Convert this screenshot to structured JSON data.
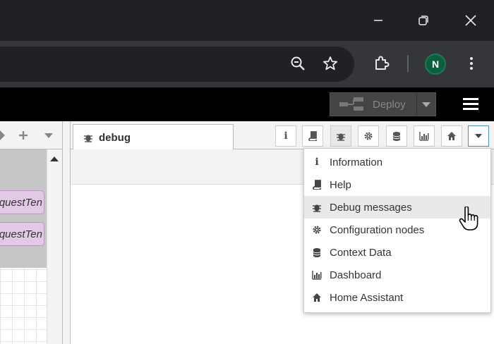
{
  "browser": {
    "window_controls": [
      "minimize",
      "restore",
      "close"
    ],
    "profile_initial": "N"
  },
  "nodered": {
    "deploy_label": "Deploy"
  },
  "workspace": {
    "nodes": [
      {
        "label": "questTen"
      },
      {
        "label": "questTen"
      }
    ]
  },
  "sidebar": {
    "active_tab": "debug",
    "buttons": [
      {
        "name": "info-icon",
        "glyph": "i"
      },
      {
        "name": "book-icon"
      },
      {
        "name": "bug-icon"
      },
      {
        "name": "gear-icon"
      },
      {
        "name": "database-icon"
      },
      {
        "name": "bar-chart-icon"
      },
      {
        "name": "home-icon"
      },
      {
        "name": "caret-down-icon"
      }
    ],
    "dropdown": {
      "items": [
        {
          "label": "Information",
          "icon": "info-icon"
        },
        {
          "label": "Help",
          "icon": "book-icon"
        },
        {
          "label": "Debug messages",
          "icon": "bug-icon",
          "hovered": true
        },
        {
          "label": "Configuration nodes",
          "icon": "gear-icon"
        },
        {
          "label": "Context Data",
          "icon": "database-icon"
        },
        {
          "label": "Dashboard",
          "icon": "bar-chart-icon"
        },
        {
          "label": "Home Assistant",
          "icon": "home-icon"
        }
      ]
    }
  }
}
